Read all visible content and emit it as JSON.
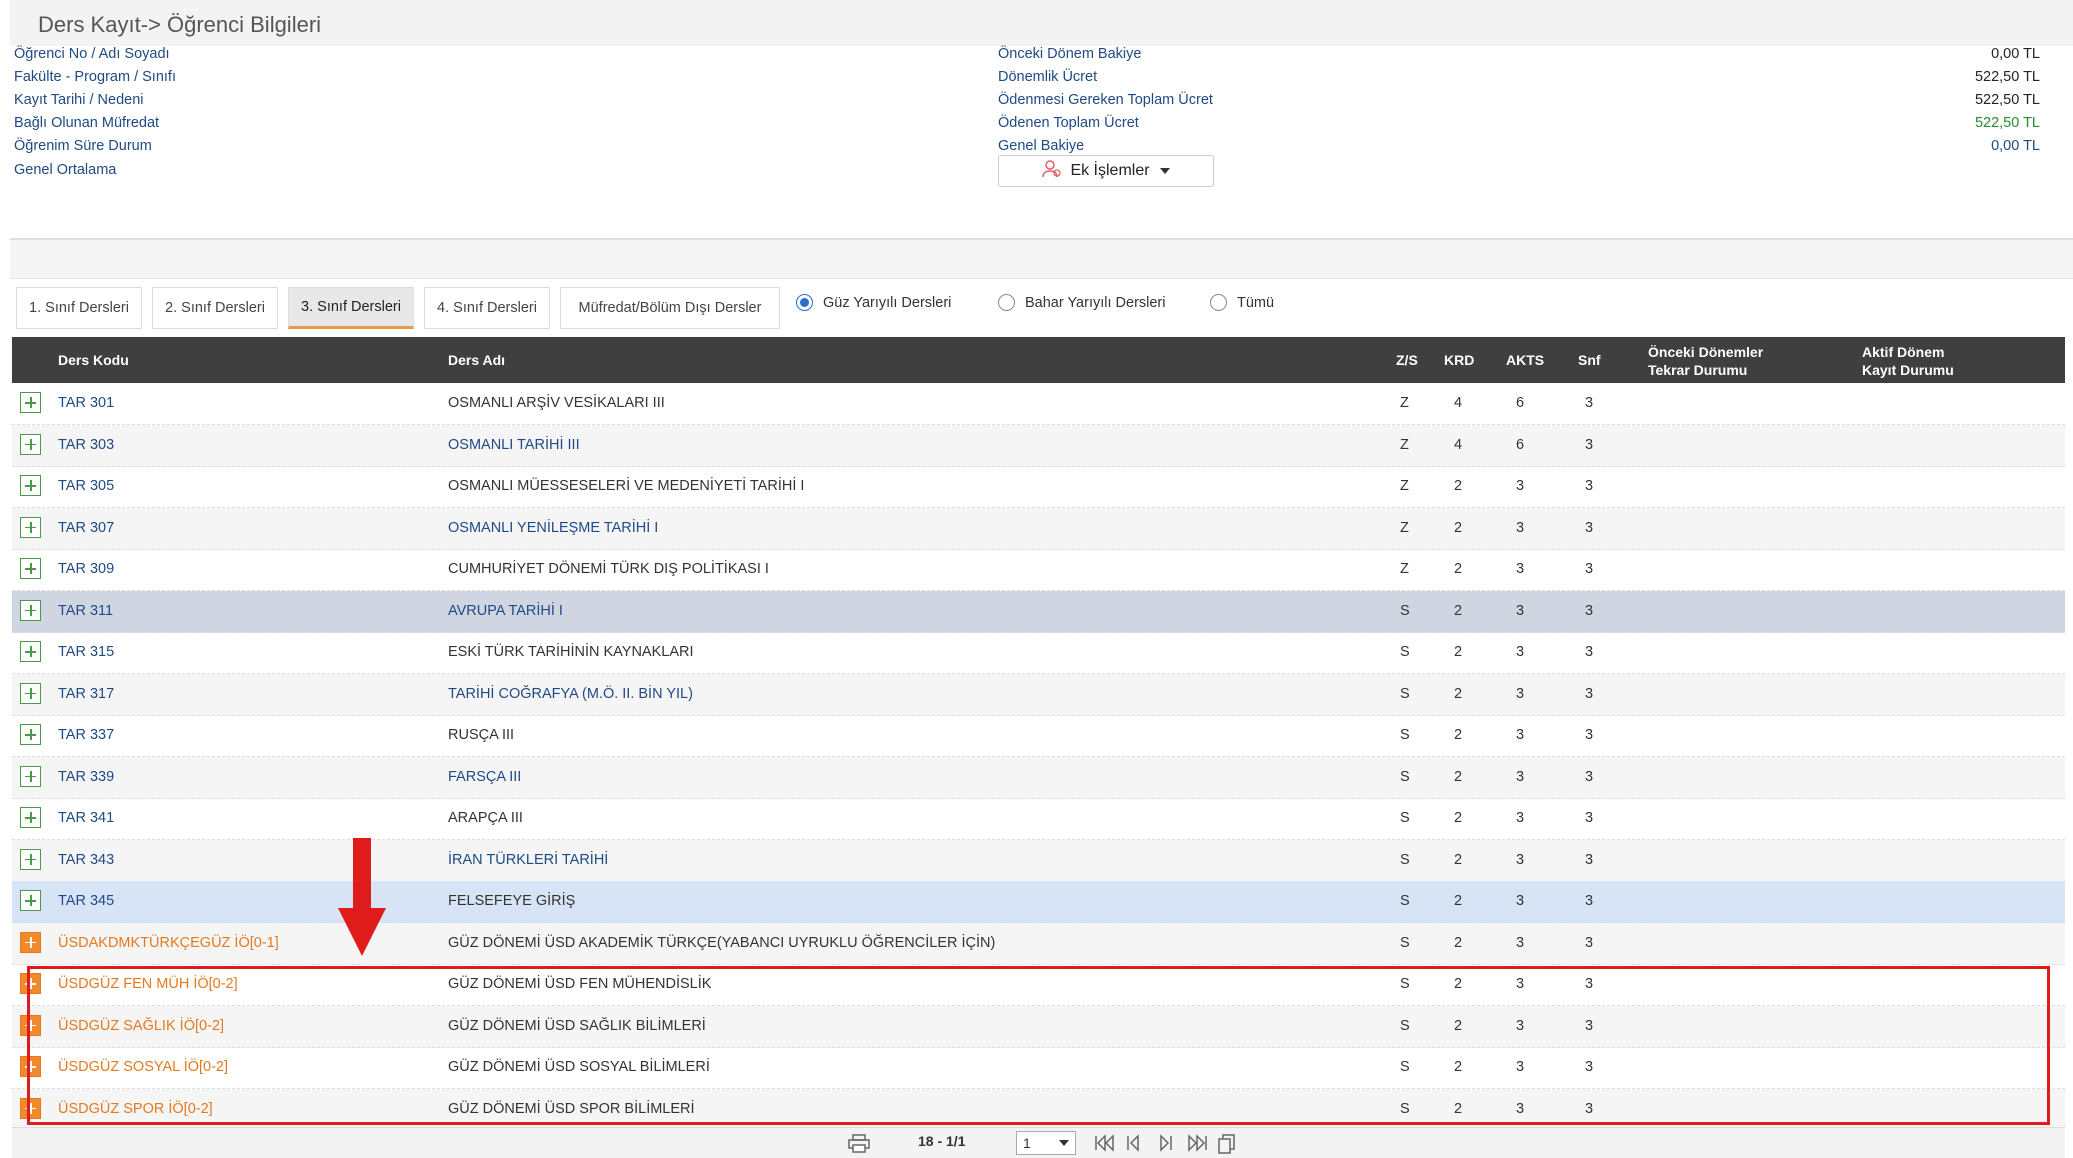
{
  "page": {
    "title": "Ders Kayıt-> Öğrenci Bilgileri"
  },
  "info": {
    "left_labels": [
      "Öğrenci No / Adı Soyadı",
      "Fakülte - Program / Sınıfı",
      "Kayıt Tarihi / Nedeni",
      "Bağlı Olunan Müfredat",
      "Öğrenim Süre Durum",
      "Genel Ortalama"
    ],
    "right_labels": [
      "Önceki Dönem Bakiye",
      "Dönemlik Ücret",
      "Ödenmesi Gereken Toplam Ücret",
      "Ödenen Toplam Ücret",
      "Genel Bakiye"
    ],
    "right_values": [
      "0,00 TL",
      "522,50 TL",
      "522,50 TL",
      "522,50 TL",
      "0,00 TL"
    ],
    "ek_islemler_label": "Ek İşlemler"
  },
  "tabs": [
    "1. Sınıf Dersleri",
    "2. Sınıf Dersleri",
    "3. Sınıf Dersleri",
    "4. Sınıf Dersleri",
    "Müfredat/Bölüm Dışı Dersler"
  ],
  "active_tab": "3. Sınıf Dersleri",
  "filters": [
    "Güz Yarıyılı Dersleri",
    "Bahar Yarıyılı Dersleri",
    "Tümü"
  ],
  "selected_filter": "Güz Yarıyılı Dersleri",
  "table": {
    "headers": {
      "code": "Ders Kodu",
      "name": "Ders Adı",
      "zs": "Z/S",
      "krd": "KRD",
      "akts": "AKTS",
      "snf": "Snf",
      "prev_line1": "Önceki Dönemler",
      "prev_line2": "Tekrar Durumu",
      "active_line1": "Aktif Dönem",
      "active_line2": "Kayıt Durumu"
    },
    "rows": [
      {
        "code": "TAR 301",
        "name": "OSMANLI ARŞİV VESİKALARI III",
        "zs": "Z",
        "krd": "4",
        "akts": "6",
        "snf": "3"
      },
      {
        "code": "TAR 303",
        "name": "OSMANLI TARİHİ III",
        "zs": "Z",
        "krd": "4",
        "akts": "6",
        "snf": "3"
      },
      {
        "code": "TAR 305",
        "name": "OSMANLI MÜESSESELERİ VE MEDENİYETİ TARİHİ I",
        "zs": "Z",
        "krd": "2",
        "akts": "3",
        "snf": "3"
      },
      {
        "code": "TAR 307",
        "name": "OSMANLI YENİLEŞME TARİHİ I",
        "zs": "Z",
        "krd": "2",
        "akts": "3",
        "snf": "3"
      },
      {
        "code": "TAR 309",
        "name": "CUMHURİYET DÖNEMİ TÜRK DIŞ POLİTİKASI I",
        "zs": "Z",
        "krd": "2",
        "akts": "3",
        "snf": "3"
      },
      {
        "code": "TAR 311",
        "name": "AVRUPA TARİHİ I",
        "zs": "S",
        "krd": "2",
        "akts": "3",
        "snf": "3"
      },
      {
        "code": "TAR 315",
        "name": "ESKİ TÜRK TARİHİNİN KAYNAKLARI",
        "zs": "S",
        "krd": "2",
        "akts": "3",
        "snf": "3"
      },
      {
        "code": "TAR 317",
        "name": "TARİHİ COĞRAFYA (M.Ö. II. BİN YIL)",
        "zs": "S",
        "krd": "2",
        "akts": "3",
        "snf": "3"
      },
      {
        "code": "TAR 337",
        "name": "RUSÇA III",
        "zs": "S",
        "krd": "2",
        "akts": "3",
        "snf": "3"
      },
      {
        "code": "TAR 339",
        "name": "FARSÇA III",
        "zs": "S",
        "krd": "2",
        "akts": "3",
        "snf": "3"
      },
      {
        "code": "TAR 341",
        "name": "ARAPÇA III",
        "zs": "S",
        "krd": "2",
        "akts": "3",
        "snf": "3"
      },
      {
        "code": "TAR 343",
        "name": "İRAN TÜRKLERİ TARİHİ",
        "zs": "S",
        "krd": "2",
        "akts": "3",
        "snf": "3"
      },
      {
        "code": "TAR 345",
        "name": "FELSEFEYE GİRİŞ",
        "zs": "S",
        "krd": "2",
        "akts": "3",
        "snf": "3"
      },
      {
        "code": "ÜSDAKDMKTÜRKÇEGÜZ İÖ[0-1]",
        "name": "GÜZ DÖNEMİ ÜSD AKADEMİK TÜRKÇE(YABANCI UYRUKLU ÖĞRENCİLER İÇİN)",
        "zs": "S",
        "krd": "2",
        "akts": "3",
        "snf": "3"
      },
      {
        "code": "ÜSDGÜZ FEN MÜH İÖ[0-2]",
        "name": "GÜZ DÖNEMİ ÜSD FEN MÜHENDİSLİK",
        "zs": "S",
        "krd": "2",
        "akts": "3",
        "snf": "3"
      },
      {
        "code": "ÜSDGÜZ SAĞLIK İÖ[0-2]",
        "name": "GÜZ DÖNEMİ ÜSD SAĞLIK BİLİMLERİ",
        "zs": "S",
        "krd": "2",
        "akts": "3",
        "snf": "3"
      },
      {
        "code": "ÜSDGÜZ SOSYAL İÖ[0-2]",
        "name": "GÜZ DÖNEMİ ÜSD SOSYAL BİLİMLERİ",
        "zs": "S",
        "krd": "2",
        "akts": "3",
        "snf": "3"
      },
      {
        "code": "ÜSDGÜZ SPOR İÖ[0-2]",
        "name": "GÜZ DÖNEMİ ÜSD SPOR BİLİMLERİ",
        "zs": "S",
        "krd": "2",
        "akts": "3",
        "snf": "3"
      }
    ]
  },
  "pager": {
    "summary": "18 - 1/1",
    "page_select_value": "1"
  },
  "icons": [
    "print-icon",
    "first-page-icon",
    "prev-page-icon",
    "next-page-icon",
    "last-page-icon",
    "copy-icon",
    "user-icon",
    "expand-icon",
    "down-arrow-icon"
  ],
  "colors": {
    "link_blue": "#1f4a84",
    "orange": "#e47a1f",
    "green_value": "#2c8a2c",
    "header_dark": "#3f3f3f",
    "highlight_red": "#e01b1b"
  }
}
